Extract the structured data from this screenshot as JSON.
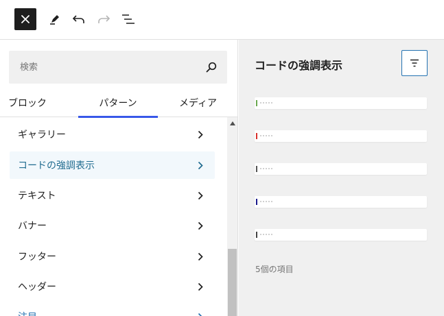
{
  "toolbar": {
    "close_icon": "close-icon",
    "tool_icon": "pencil-icon",
    "undo_icon": "undo-icon",
    "redo_icon": "redo-icon",
    "list_view_icon": "list-view-icon"
  },
  "inserter": {
    "search": {
      "placeholder": "検索",
      "value": ""
    },
    "tabs": [
      {
        "label": "ブロック",
        "selected": false
      },
      {
        "label": "パターン",
        "selected": true
      },
      {
        "label": "メディア",
        "selected": false
      }
    ],
    "categories": [
      {
        "label": "ギャラリー",
        "active": false
      },
      {
        "label": "コードの強調表示",
        "active": true
      },
      {
        "label": "テキスト",
        "active": false
      },
      {
        "label": "バナー",
        "active": false
      },
      {
        "label": "フッター",
        "active": false
      },
      {
        "label": "ヘッダー",
        "active": false
      },
      {
        "label": "注目",
        "active": false
      }
    ]
  },
  "patterns_panel": {
    "title": "コードの強調表示",
    "filter_icon": "filter-icon",
    "previews": [
      {
        "accent": "#6aa84f"
      },
      {
        "accent": "#d9302c"
      },
      {
        "accent": "#555555"
      },
      {
        "accent": "#1a1a8c"
      },
      {
        "accent": "#444444"
      }
    ],
    "count_label": "5個の項目"
  },
  "colors": {
    "accent": "#3858e9",
    "active_text": "#1f6b8f",
    "active_bg": "#f2f8fc",
    "filter_border": "#2271b1"
  }
}
